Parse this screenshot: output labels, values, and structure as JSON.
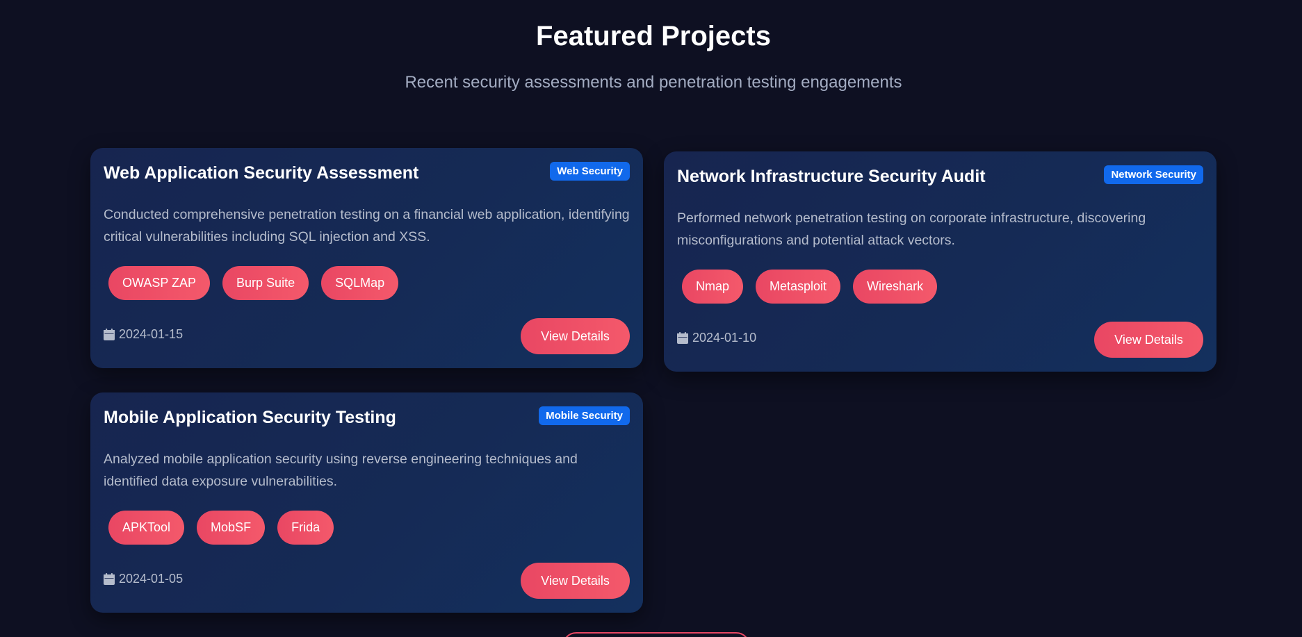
{
  "section": {
    "title": "Featured Projects",
    "subtitle": "Recent security assessments and penetration testing engagements"
  },
  "colors": {
    "background": "#0e1022",
    "badge": "#1169ec",
    "accent": "#e94763",
    "card": "#152a55"
  },
  "projects": [
    {
      "title": "Web Application Security Assessment",
      "category": "Web Security",
      "description": "Conducted comprehensive penetration testing on a financial web application, identifying critical vulnerabilities including SQL injection and XSS.",
      "tools": [
        "OWASP ZAP",
        "Burp Suite",
        "SQLMap"
      ],
      "date": "2024-01-15",
      "date_icon": "calendar-icon",
      "button_label": "View Details"
    },
    {
      "title": "Network Infrastructure Security Audit",
      "category": "Network Security",
      "description": "Performed network penetration testing on corporate infrastructure, discovering misconfigurations and potential attack vectors.",
      "tools": [
        "Nmap",
        "Metasploit",
        "Wireshark"
      ],
      "date": "2024-01-10",
      "date_icon": "calendar-icon",
      "button_label": "View Details"
    },
    {
      "title": "Mobile Application Security Testing",
      "category": "Mobile Security",
      "description": "Analyzed mobile application security using reverse engineering techniques and identified data exposure vulnerabilities.",
      "tools": [
        "APKTool",
        "MobSF",
        "Frida"
      ],
      "date": "2024-01-05",
      "date_icon": "calendar-icon",
      "button_label": "View Details"
    }
  ]
}
